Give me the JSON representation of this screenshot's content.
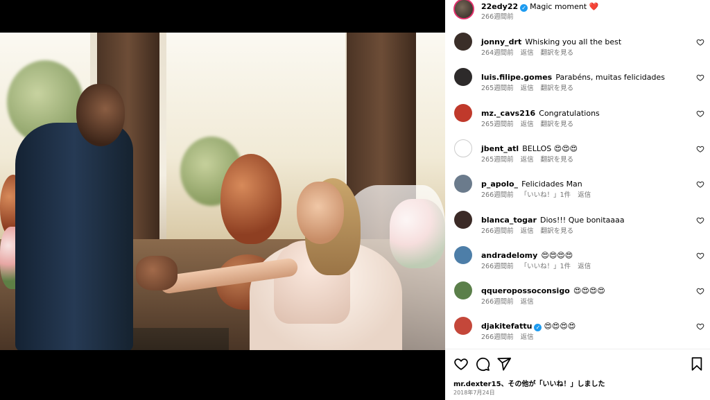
{
  "post": {
    "username": "22edy22",
    "caption": "Magic moment ❤️",
    "time": "266週間前"
  },
  "labels": {
    "reply": "返信",
    "see_translation": "翻訳を見る"
  },
  "comments": [
    {
      "user": "jonny_drt",
      "text": "Whisking you all the best",
      "time": "264週間前",
      "actions": [
        "返信",
        "翻訳を見る"
      ],
      "avatar_color": "#3a2e28"
    },
    {
      "user": "luis.filipe.gomes",
      "text": "Parabéns, muitas felicidades",
      "time": "265週間前",
      "actions": [
        "返信",
        "翻訳を見る"
      ],
      "avatar_color": "#2d2a2a"
    },
    {
      "user": "mz._cavs216",
      "text": "Congratulations",
      "time": "265週間前",
      "actions": [
        "返信",
        "翻訳を見る"
      ],
      "avatar_color": "#c0392b"
    },
    {
      "user": "jbent_atl",
      "text": "BELLOS 😍😍😍",
      "time": "265週間前",
      "actions": [
        "返信",
        "翻訳を見る"
      ],
      "avatar_color": "#ffffff"
    },
    {
      "user": "p_apolo_",
      "text": "Felicidades Man",
      "time": "266週間前",
      "actions": [
        "「いいね！」1件",
        "返信"
      ],
      "avatar_color": "#6b7b8c"
    },
    {
      "user": "blanca_togar",
      "text": "Dios!!! Que bonitaaaa",
      "time": "266週間前",
      "actions": [
        "返信",
        "翻訳を見る"
      ],
      "avatar_color": "#3b2a26"
    },
    {
      "user": "andradelomy",
      "text": "😍😍😍😍",
      "time": "266週間前",
      "actions": [
        "「いいね！」1件",
        "返信"
      ],
      "avatar_color": "#4d7ea8"
    },
    {
      "user": "qqueroposso​consigo",
      "text": "😍😍😍😍",
      "time": "266週間前",
      "actions": [
        "返信"
      ],
      "avatar_color": "#5b7f4a"
    },
    {
      "user": "djakitefattu",
      "text": "😍😍😍😍",
      "time": "266週間前",
      "actions": [
        "返信"
      ],
      "avatar_color": "#c4473a",
      "verified": true
    }
  ],
  "likes_text": "mr.dexter15、その他が「いいね！」しました",
  "date": "2018年7月24日",
  "icons": {
    "like": "heart-icon",
    "comment": "comment-icon",
    "share": "share-icon",
    "save": "bookmark-icon"
  }
}
